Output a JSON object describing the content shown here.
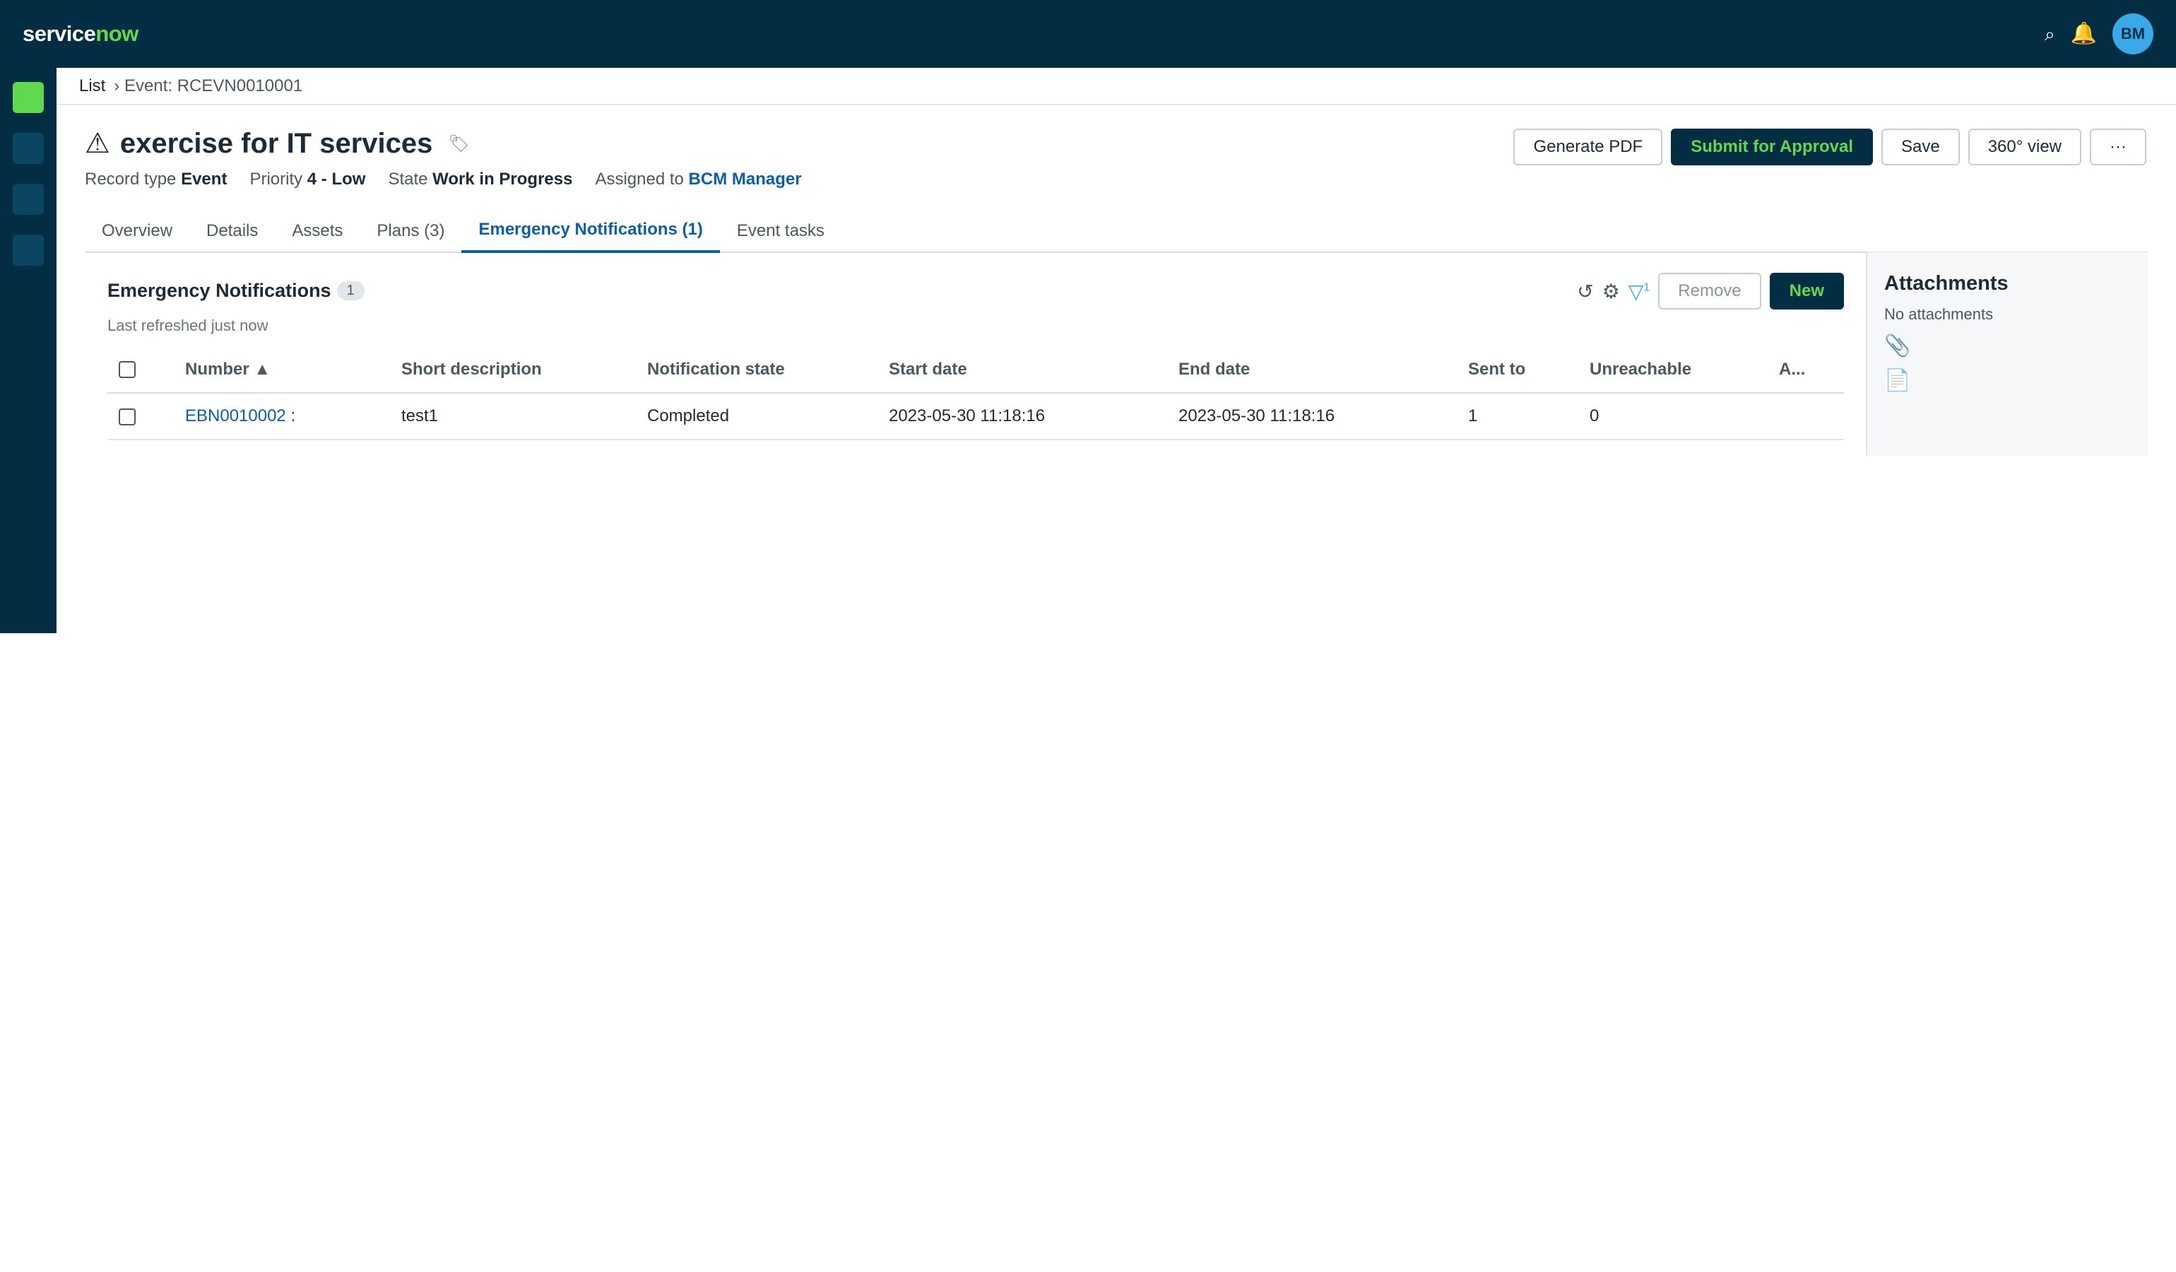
{
  "brand": {
    "part1": "service",
    "part2": "now"
  },
  "topbar": {
    "search_icon": "⌕",
    "bell_icon": "🔔",
    "avatar": "BM"
  },
  "breadcrumb": {
    "list": "List",
    "current": "› Event: RCEVN0010001"
  },
  "record": {
    "warning_icon": "⚠",
    "title": "exercise for IT services",
    "tag_icon": "🏷",
    "meta": {
      "type_label": "Record type",
      "type_value": "Event",
      "priority_label": "Priority",
      "priority_value": "4 - Low",
      "state_label": "State",
      "state_value": "Work in Progress",
      "assigned_label": "Assigned to",
      "assigned_value": "BCM Manager"
    }
  },
  "actions": {
    "generate_pdf": "Generate PDF",
    "submit": "Submit for Approval",
    "save": "Save",
    "view360": "360° view",
    "more": "···"
  },
  "tabs": [
    {
      "label": "Overview"
    },
    {
      "label": "Details"
    },
    {
      "label": "Assets"
    },
    {
      "label": "Plans (3)"
    },
    {
      "label": "Emergency Notifications (1)",
      "active": true
    },
    {
      "label": "Event tasks"
    }
  ],
  "panel": {
    "title": "Emergency Notifications",
    "count": "1",
    "refreshed": "Last refreshed just now",
    "refresh_icon": "↺",
    "settings_icon": "⚙",
    "filter_icon": "▽",
    "filter_count": "1",
    "remove": "Remove",
    "new": "New"
  },
  "table": {
    "columns": [
      "Number ▲",
      "Short description",
      "Notification state",
      "Start date",
      "End date",
      "Sent to",
      "Unreachable",
      "A..."
    ],
    "rows": [
      {
        "number": "EBN0010002",
        "suffix": ":",
        "description": "test1",
        "state": "Completed",
        "start": "2023-05-30 11:18:16",
        "end": "2023-05-30 11:18:16",
        "sent": "1",
        "unreachable": "0",
        "a": ""
      }
    ]
  },
  "attachments": {
    "title": "Attachments",
    "empty": "No attachments",
    "clip_icon": "📎",
    "doc_icon": "📄"
  },
  "colors": {
    "header_bg": "#032d42",
    "accent_green": "#62d84e",
    "link_blue": "#0b5ea8",
    "filter_blue": "#3aa9e8"
  }
}
